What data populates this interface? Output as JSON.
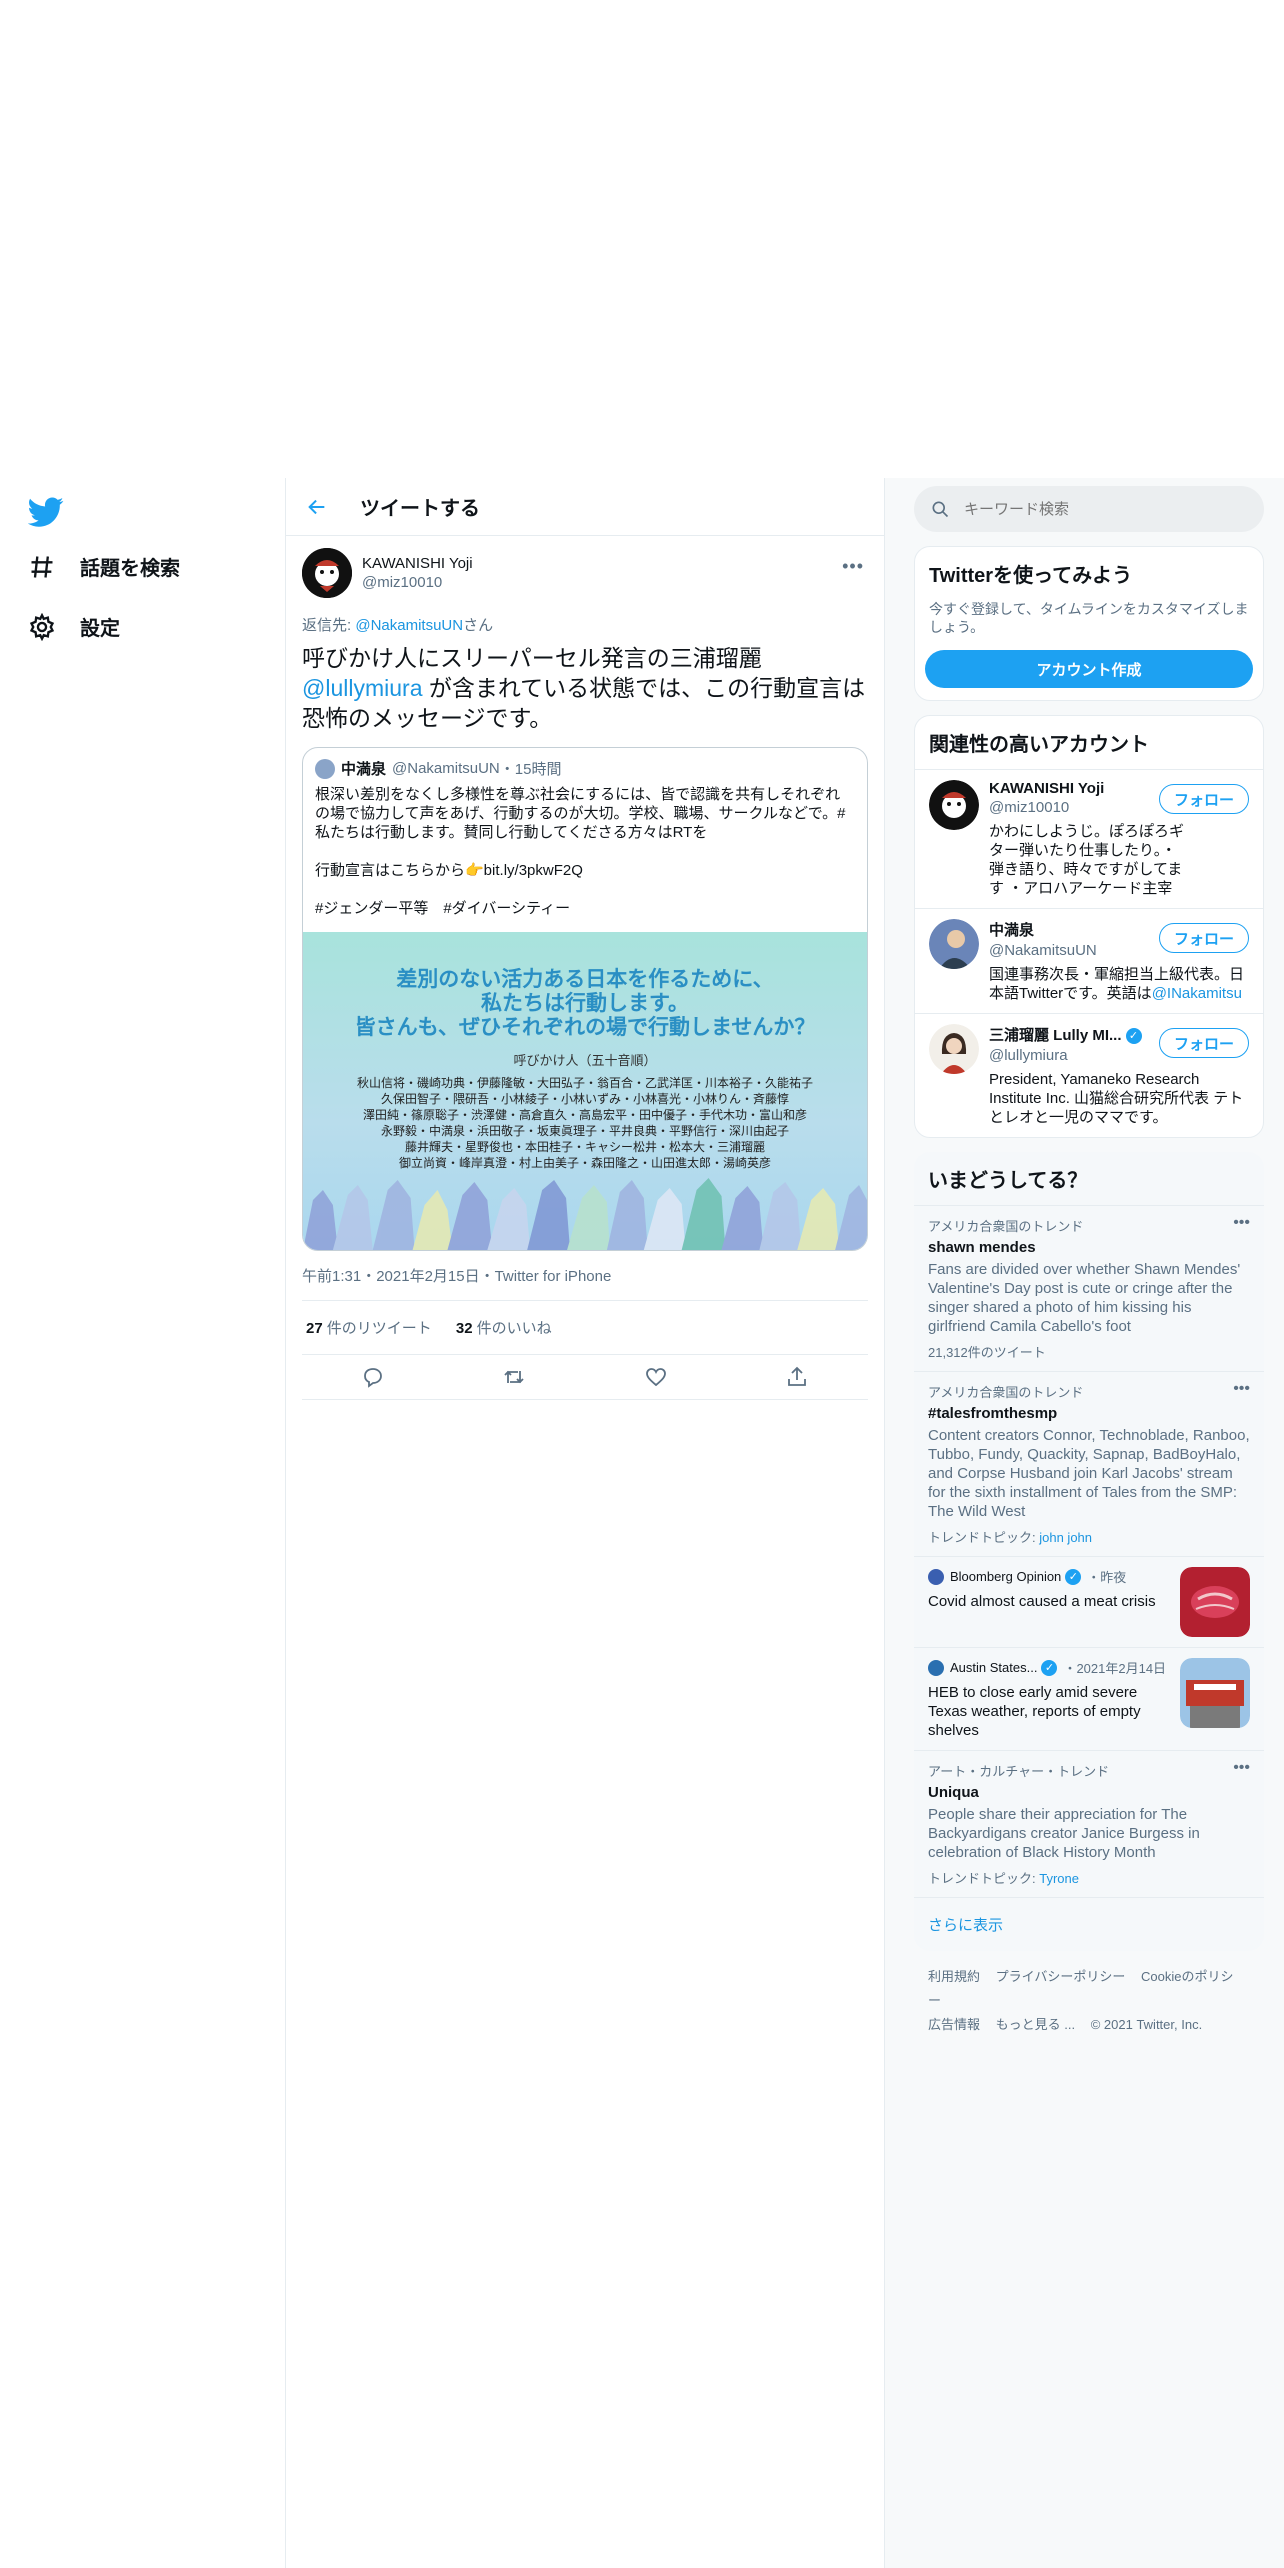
{
  "nav": {
    "items": [
      {
        "label": "話題を検索",
        "icon": "hashtag-icon"
      },
      {
        "label": "設定",
        "icon": "gear-icon"
      }
    ]
  },
  "main": {
    "title": "ツイートする",
    "tweet": {
      "author_name": "KAWANISHI Yoji",
      "author_handle": "@miz10010",
      "reply_prefix": "返信先: ",
      "reply_handle": "@NakamitsuUN",
      "reply_suffix": "さん",
      "text_part1": "呼びかけ人にスリーパーセル発言の三浦瑠麗",
      "text_mention": "@lullymiura",
      "text_part2": " が含まれている状態では、この行動宣言は恐怖のメッセージです。",
      "quote": {
        "name": "中満泉",
        "handle": "@NakamitsuUN",
        "time": "・15時間",
        "body": "根深い差別をなくし多様性を尊ぶ社会にするには、皆で認識を共有しそれぞれの場で協力して声をあげ、行動するのが大切。学校、職場、サークルなどで。#私たちは行動します。賛同し行動してくださる方々はRTを\n\n行動宣言はこちらから👉bit.ly/3pkwF2Q\n\n#ジェンダー平等　#ダイバーシティー",
        "image_headline_1": "差別のない活力ある日本を作るために、",
        "image_headline_2": "私たちは行動します。",
        "image_headline_3": "皆さんも、ぜひそれぞれの場で行動しませんか？",
        "image_sub": "呼びかけ人（五十音順）",
        "image_names": [
          "秋山信将・磯崎功典・伊藤隆敏・大田弘子・翁百合・乙武洋匡・川本裕子・久能祐子",
          "久保田智子・隈研吾・小林綾子・小林いずみ・小林喜光・小林りん・斉藤惇",
          "澤田純・篠原聡子・渋澤健・高倉直久・高島宏平・田中優子・手代木功・富山和彦",
          "永野毅・中満泉・浜田敬子・坂東眞理子・平井良典・平野信行・深川由起子",
          "藤井輝夫・星野俊也・本田桂子・キャシー松井・松本大・三浦瑠麗",
          "御立尚資・峰岸真澄・村上由美子・森田隆之・山田進太郎・湯崎英彦"
        ]
      },
      "meta": "午前1:31・2021年2月15日・Twitter for iPhone",
      "retweets_count": "27",
      "retweets_label": "件のリツイート",
      "likes_count": "32",
      "likes_label": "件のいいね"
    }
  },
  "search": {
    "placeholder": "キーワード検索"
  },
  "signup": {
    "title": "Twitterを使ってみよう",
    "desc": "今すぐ登録して、タイムラインをカスタマイズしましょう。",
    "button": "アカウント作成"
  },
  "relevant": {
    "title": "関連性の高いアカウント",
    "follow_label": "フォロー",
    "accounts": [
      {
        "name": "KAWANISHI Yoji",
        "handle": "@miz10010",
        "bio": "かわにしようじ。ぽろぽろギター弾いたり仕事したり。・弾き語り、時々ですがしてます ・アロハアーケード主宰"
      },
      {
        "name": "中満泉",
        "handle": "@NakamitsuUN",
        "bio": "国連事務次長・軍縮担当上級代表。日本語Twitterです。英語は",
        "bio_link": "@INakamitsu"
      },
      {
        "name": "三浦瑠麗 Lully MI...",
        "handle": "@lullymiura",
        "bio": "President, Yamaneko Research Institute Inc. 山猫総合研究所代表 テトとレオと一児のママです。"
      }
    ]
  },
  "trends": {
    "title": "いまどうしてる？",
    "items": [
      {
        "context": "アメリカ合衆国のトレンド",
        "name": "shawn mendes",
        "desc": "Fans are divided over whether Shawn Mendes' Valentine's Day post is cute or cringe after the singer shared a photo of him kissing his girlfriend Camila Cabello's foot",
        "foot": "21,312件のツイート"
      },
      {
        "context": "アメリカ合衆国のトレンド",
        "name": "#talesfromthesmp",
        "desc": "Content creators Connor, Technoblade, Ranboo, Tubbo, Fundy, Quackity, Sapnap, BadBoyHalo, and Corpse Husband join Karl Jacobs' stream for the sixth installment of Tales from the SMP: The Wild West",
        "foot_label": "トレンドトピック: ",
        "foot_link": "john john"
      }
    ],
    "news": [
      {
        "source": "Bloomberg Opinion",
        "time": "・昨夜",
        "title": "Covid almost caused a meat crisis"
      },
      {
        "source": "Austin States...",
        "time": "・2021年2月14日",
        "title": "HEB to close early amid severe Texas weather, reports of empty shelves"
      }
    ],
    "trend3": {
      "context": "アート・カルチャー・トレンド",
      "name": "Uniqua",
      "desc": "People share their appreciation for The Backyardigans creator Janice Burgess in celebration of Black History Month",
      "foot_label": "トレンドトピック: ",
      "foot_link": "Tyrone"
    },
    "show_more": "さらに表示"
  },
  "footer": {
    "links": [
      "利用規約",
      "プライバシーポリシー",
      "Cookieのポリシー",
      "広告情報",
      "もっと見る ..."
    ],
    "copyright": "© 2021 Twitter, Inc."
  },
  "colors": {
    "accent": "#1da1f2",
    "link": "#1b95e0"
  }
}
